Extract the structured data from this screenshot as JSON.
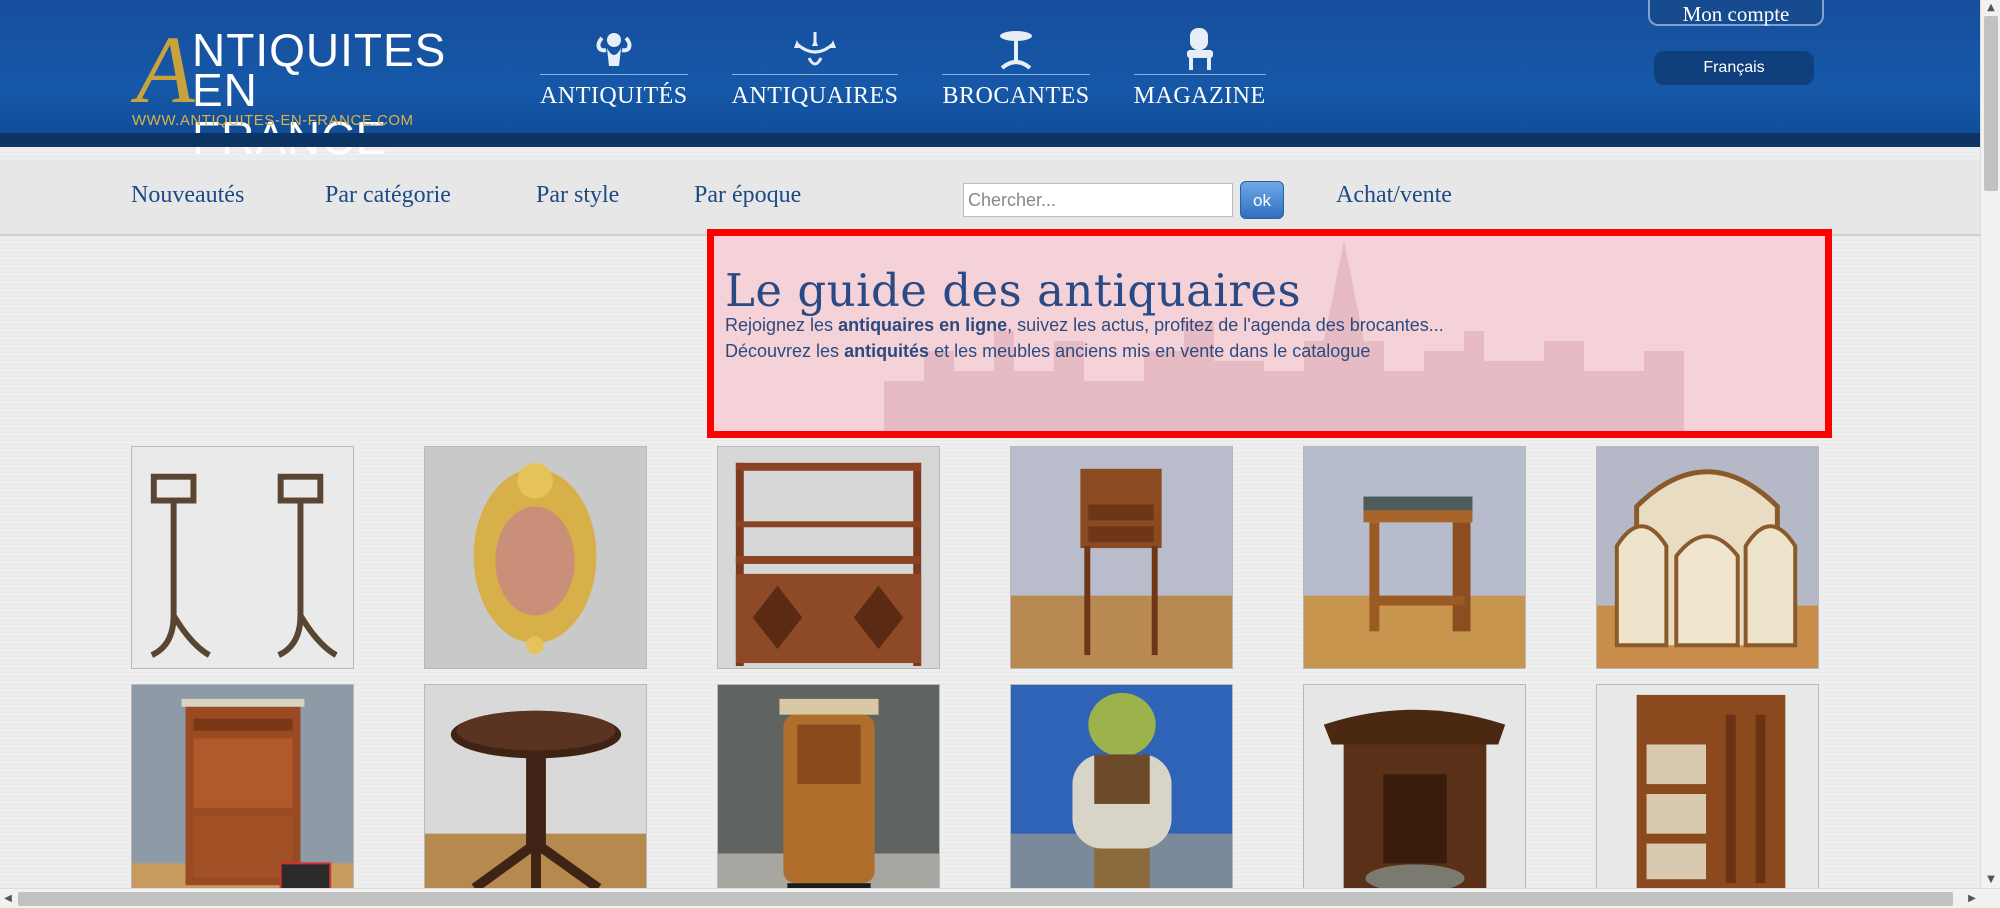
{
  "logo": {
    "big_letter": "A",
    "line1": "NTIQUITES",
    "line2": "EN FRANCE",
    "url": "WWW.ANTIQUITES-EN-FRANCE.COM"
  },
  "main_nav": [
    {
      "label": "ANTIQUITÉS",
      "icon": "cherub-icon"
    },
    {
      "label": "ANTIQUAIRES",
      "icon": "chandelier-icon"
    },
    {
      "label": "BROCANTES",
      "icon": "gueridon-table-icon"
    },
    {
      "label": "MAGAZINE",
      "icon": "armchair-icon"
    }
  ],
  "account": {
    "label": "Mon compte"
  },
  "language": {
    "label": "Français"
  },
  "sub_nav": {
    "new": "Nouveautés",
    "by_category": "Par catégorie",
    "by_style": "Par style",
    "by_era": "Par époque",
    "buy_sell": "Achat/vente"
  },
  "search": {
    "placeholder": "Chercher...",
    "value": "",
    "button": "ok"
  },
  "intro": {
    "title": "Le guide des antiquaires",
    "line1_a": "Rejoignez les ",
    "line1_b": "antiquaires en ligne",
    "line1_c": ", suivez les actus, profitez de l'agenda des brocantes...",
    "line2_a": "Découvrez les ",
    "line2_b": "antiquités",
    "line2_c": " et les meubles anciens mis en vente dans le catalogue"
  },
  "colors": {
    "header_blue": "#1658a8",
    "link_blue": "#1d4a86",
    "gold": "#c9a23c",
    "highlight_border": "#ff0000"
  },
  "products": [
    {
      "item": "andirons-pair"
    },
    {
      "item": "gilt-bronze-wall-ornament"
    },
    {
      "item": "wall-shelf-cabinet"
    },
    {
      "item": "mahogany-side-table"
    },
    {
      "item": "art-deco-side-table"
    },
    {
      "item": "salon-chairs-set"
    },
    {
      "item": "secretaire-cabinet"
    },
    {
      "item": "round-pedestal-table"
    },
    {
      "item": "art-deco-nightstand"
    },
    {
      "item": "ogre-statue"
    },
    {
      "item": "carved-black-forest-cabinet"
    },
    {
      "item": "revolving-bookcase"
    }
  ]
}
